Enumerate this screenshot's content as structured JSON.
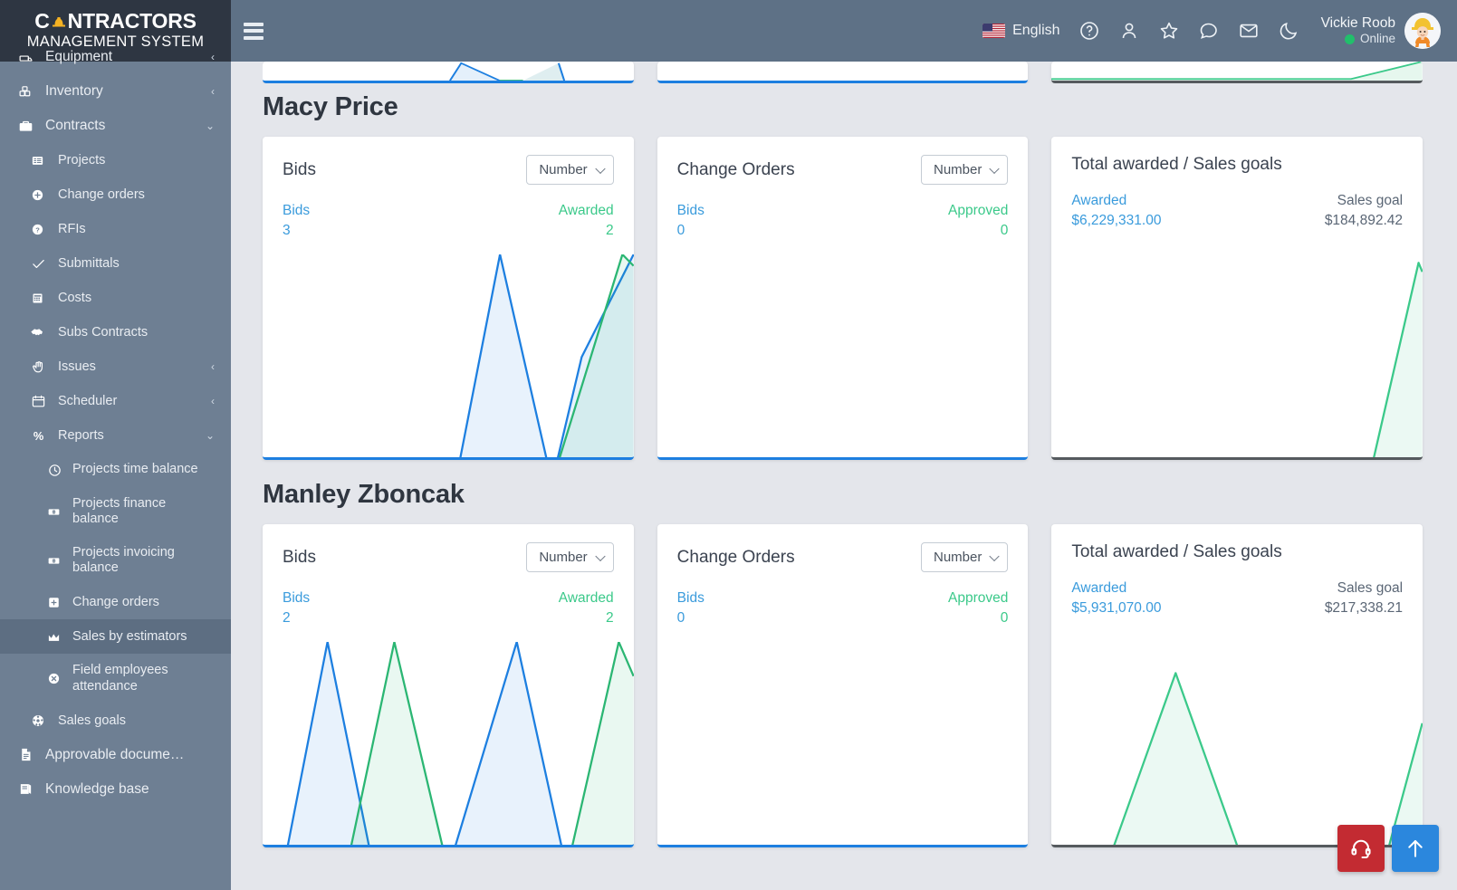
{
  "brand": {
    "line1": "C NTRACTORS",
    "line1_prefix": "C",
    "line1_suffix": "NTRACTORS",
    "line2": "MANAGEMENT SYSTEM",
    "helmet_icon": "hard-hat-icon"
  },
  "topbar": {
    "menu_icon": "hamburger-menu-icon",
    "language": "English",
    "flag_icon": "us-flag-icon",
    "icons": [
      {
        "name": "help-circle-icon",
        "glyph": "?"
      },
      {
        "name": "user-icon",
        "glyph": "person"
      },
      {
        "name": "star-icon",
        "glyph": "star"
      },
      {
        "name": "chat-bubble-icon",
        "glyph": "chat"
      },
      {
        "name": "envelope-icon",
        "glyph": "mail"
      },
      {
        "name": "moon-icon",
        "glyph": "moon"
      }
    ],
    "user_name": "Vickie Roob",
    "user_status": "Online",
    "avatar_icon": "worker-avatar"
  },
  "sidebar": {
    "items": [
      {
        "label": "Equipment",
        "icon": "equipment-icon",
        "level": "top",
        "arrow": "‹",
        "clipped": true
      },
      {
        "label": "Inventory",
        "icon": "inventory-boxes-icon",
        "level": "top",
        "arrow": "‹"
      },
      {
        "label": "Contracts",
        "icon": "briefcase-icon",
        "level": "top",
        "arrow": "⌄",
        "expanded": true
      },
      {
        "label": "Projects",
        "icon": "list-icon",
        "level": "child"
      },
      {
        "label": "Change orders",
        "icon": "plus-circle-icon",
        "level": "child"
      },
      {
        "label": "RFIs",
        "icon": "question-circle-icon",
        "level": "child"
      },
      {
        "label": "Submittals",
        "icon": "check-icon",
        "level": "child"
      },
      {
        "label": "Costs",
        "icon": "grid-calculator-icon",
        "level": "child"
      },
      {
        "label": "Subs Contracts",
        "icon": "handshake-icon",
        "level": "child"
      },
      {
        "label": "Issues",
        "icon": "hand-icon",
        "level": "child",
        "arrow": "‹"
      },
      {
        "label": "Scheduler",
        "icon": "calendar-icon",
        "level": "child",
        "arrow": "‹"
      },
      {
        "label": "Reports",
        "icon": "percent-icon",
        "level": "child",
        "arrow": "⌄",
        "expanded": true
      },
      {
        "label": "Projects time balance",
        "icon": "clock-icon",
        "level": "grandchild",
        "two_line": true
      },
      {
        "label": "Projects finance balance",
        "icon": "money-icon",
        "level": "grandchild",
        "two_line": true
      },
      {
        "label": "Projects invoicing balance",
        "icon": "money-icon",
        "level": "grandchild",
        "two_line": true
      },
      {
        "label": "Change orders",
        "icon": "plus-square-icon",
        "level": "grandchild"
      },
      {
        "label": "Sales by estimators",
        "icon": "chart-area-icon",
        "level": "grandchild",
        "active": true
      },
      {
        "label": "Field employees attendance",
        "icon": "x-circle-icon",
        "level": "grandchild",
        "two_line": true
      },
      {
        "label": "Sales goals",
        "icon": "target-ball-icon",
        "level": "child"
      },
      {
        "label": "Approvable docume…",
        "icon": "document-icon",
        "level": "top"
      },
      {
        "label": "Knowledge base",
        "icon": "book-icon",
        "level": "top"
      }
    ]
  },
  "content": {
    "sections": [
      {
        "name": "Macy Price",
        "cards": [
          {
            "title": "Bids",
            "select": "Number",
            "left_label": "Bids",
            "left_value": "3",
            "right_label": "Awarded",
            "right_value": "2",
            "accent": "blue"
          },
          {
            "title": "Change Orders",
            "select": "Number",
            "left_label": "Bids",
            "left_value": "0",
            "right_label": "Approved",
            "right_value": "0",
            "accent": "blue"
          },
          {
            "title": "Total awarded / Sales goals",
            "left_label": "Awarded",
            "left_value": "$6,229,331.00",
            "right_label": "Sales goal",
            "right_value": "$184,892.42",
            "accent": "dark"
          }
        ]
      },
      {
        "name": "Manley Zboncak",
        "cards": [
          {
            "title": "Bids",
            "select": "Number",
            "left_label": "Bids",
            "left_value": "2",
            "right_label": "Awarded",
            "right_value": "2",
            "accent": "blue"
          },
          {
            "title": "Change Orders",
            "select": "Number",
            "left_label": "Bids",
            "left_value": "0",
            "right_label": "Approved",
            "right_value": "0",
            "accent": "blue"
          },
          {
            "title": "Total awarded / Sales goals",
            "left_label": "Awarded",
            "left_value": "$5,931,070.00",
            "right_label": "Sales goal",
            "right_value": "$217,338.21",
            "accent": "dark"
          }
        ]
      }
    ]
  },
  "fabs": [
    {
      "name": "support-headset-button",
      "icon": "headset-icon",
      "color": "#c32b32"
    },
    {
      "name": "scroll-to-top-button",
      "icon": "arrow-up-icon",
      "color": "#2b87dd"
    }
  ],
  "colors": {
    "sidebar_bg": "#6e7f93",
    "sidebar_logo_bg": "#2e3642",
    "topbar_bg": "#5e7186",
    "page_bg": "#e4e6eb",
    "blue_series": "#1d7fe0",
    "green_series": "#2bb673",
    "stat_blue": "#3a9bdc",
    "stat_green": "#3bc98a",
    "online_green": "#21bf6b"
  },
  "chart_data": [
    {
      "type": "area",
      "title": "Macy Price — Bids",
      "series": [
        {
          "name": "Bids",
          "color": "#1d7fe0",
          "x": [
            0,
            0.52,
            0.64,
            0.78,
            0.86,
            1.0
          ],
          "values": [
            0,
            0,
            1,
            0,
            0.55,
            1.0
          ]
        },
        {
          "name": "Awarded",
          "color": "#2bb673",
          "x": [
            0,
            0.78,
            0.97,
            1.0
          ],
          "values": [
            0,
            0,
            1.0,
            0.95
          ]
        }
      ],
      "ylim": [
        0,
        1
      ],
      "grid": false,
      "legend": "none"
    },
    {
      "type": "area",
      "title": "Macy Price — Change Orders",
      "series": [
        {
          "name": "Bids",
          "color": "#1d7fe0",
          "x": [
            0,
            1
          ],
          "values": [
            0,
            0
          ]
        },
        {
          "name": "Approved",
          "color": "#2bb673",
          "x": [
            0,
            1
          ],
          "values": [
            0,
            0
          ]
        }
      ],
      "ylim": [
        0,
        1
      ],
      "grid": false,
      "legend": "none"
    },
    {
      "type": "area",
      "title": "Macy Price — Total awarded / Sales goals",
      "series": [
        {
          "name": "Awarded",
          "color": "#3bc98a",
          "x": [
            0,
            0.86,
            0.99,
            1.0
          ],
          "values": [
            0,
            0,
            0.92,
            0.88
          ]
        },
        {
          "name": "Sales goal",
          "color": "#555a5e",
          "x": [
            0,
            1
          ],
          "values": [
            0.01,
            0.01
          ]
        }
      ],
      "ylim": [
        0,
        1
      ],
      "grid": false,
      "legend": "none"
    },
    {
      "type": "area",
      "title": "Manley Zboncak — Bids",
      "series": [
        {
          "name": "Bids",
          "color": "#1d7fe0",
          "x": [
            0,
            0.055,
            0.175,
            0.3,
            0.5,
            0.685,
            0.82,
            1.0
          ],
          "values": [
            0,
            0,
            1.0,
            0,
            0,
            1.0,
            0,
            0
          ]
        },
        {
          "name": "Awarded",
          "color": "#2bb673",
          "x": [
            0,
            0.225,
            0.355,
            0.5,
            0.82,
            0.96,
            1.0
          ],
          "values": [
            0,
            0,
            1.0,
            0,
            0,
            1.0,
            0.85
          ]
        }
      ],
      "ylim": [
        0,
        1
      ],
      "grid": false,
      "legend": "none"
    },
    {
      "type": "area",
      "title": "Manley Zboncak — Change Orders",
      "series": [
        {
          "name": "Bids",
          "color": "#1d7fe0",
          "x": [
            0,
            1
          ],
          "values": [
            0,
            0
          ]
        },
        {
          "name": "Approved",
          "color": "#2bb673",
          "x": [
            0,
            1
          ],
          "values": [
            0,
            0
          ]
        }
      ],
      "ylim": [
        0,
        1
      ],
      "grid": false,
      "legend": "none"
    },
    {
      "type": "area",
      "title": "Manley Zboncak — Total awarded / Sales goals",
      "series": [
        {
          "name": "Awarded",
          "color": "#3bc98a",
          "x": [
            0,
            0.155,
            0.335,
            0.515,
            0.9,
            1.0
          ],
          "values": [
            0,
            0,
            0.82,
            0,
            0,
            0.6
          ]
        },
        {
          "name": "Sales goal",
          "color": "#555a5e",
          "x": [
            0,
            1
          ],
          "values": [
            0.01,
            0.01
          ]
        }
      ],
      "ylim": [
        0,
        1
      ],
      "grid": false,
      "legend": "none"
    }
  ]
}
